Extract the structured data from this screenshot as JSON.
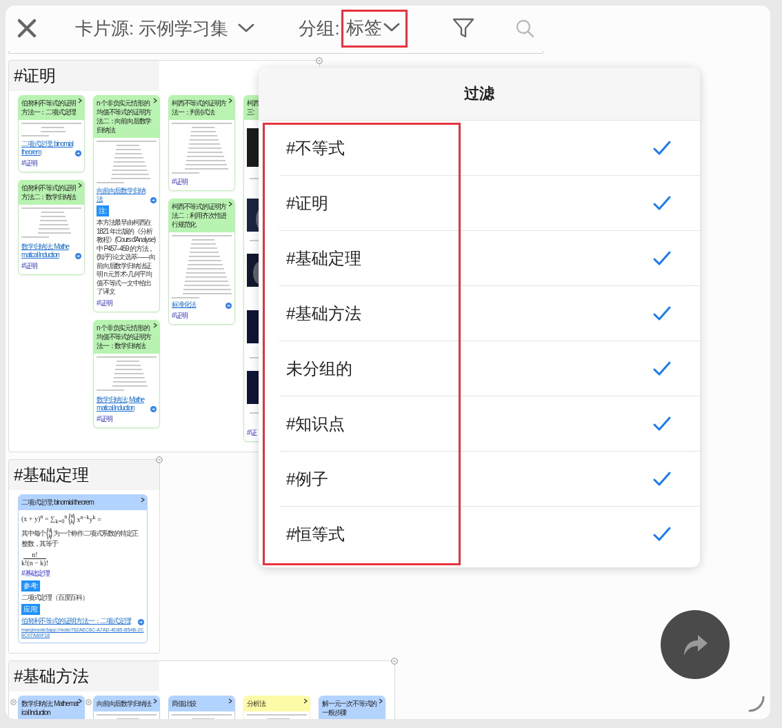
{
  "toolbar": {
    "source_label": "卡片源: 示例学习集",
    "group_label": "分组:",
    "group_value": "标签",
    "group_highlighted": true
  },
  "sections": [
    {
      "title": "#证明",
      "collapsed": false,
      "columns": [
        {
          "cards": [
            {
              "title": "伯努利不等式的证明方法一：二项式定理",
              "color": "#b9f3b1",
              "flagged": false,
              "blocks": [
                {
                  "kind": "formula"
                },
                {
                  "kind": "link",
                  "text": "二项式定理; binomial theorem",
                  "arrow": true
                },
                {
                  "kind": "tag",
                  "text": "#证明"
                }
              ]
            },
            {
              "title": "伯努利不等式的证明方法二：数学归纳法",
              "color": "#b9f3b1",
              "flagged": false,
              "blocks": [
                {
                  "kind": "formula"
                },
                {
                  "kind": "link",
                  "text": "数学归纳法; Mathematical Induction",
                  "arrow": true
                },
                {
                  "kind": "tag",
                  "text": "#证明"
                }
              ]
            }
          ]
        },
        {
          "cards": [
            {
              "title": "n 个非负实元情形的均值不等式的证明方法二：向前向后数学归纳法",
              "color": "#b9f3b1",
              "flagged": false,
              "blocks": [
                {
                  "kind": "formula"
                },
                {
                  "kind": "link",
                  "text": "向前向后数学归纳法",
                  "arrow": true
                },
                {
                  "kind": "label",
                  "text": "注:"
                },
                {
                  "kind": "text",
                  "text": "本方法最早由柯西在 1821 年出版的《分析教程》(Cours d'Analyse) 中 P457–459 的方法，(知乎) 论文选萃——向前向后数学归纳法证明 n 元算术-几何平均值不等式一文中给出了译文"
                },
                {
                  "kind": "tag",
                  "text": "#证明"
                }
              ]
            },
            {
              "title": "n 个非负实元情形的均值不等式的证明方法一：数学归纳法",
              "color": "#b9f3b1",
              "flagged": false,
              "blocks": [
                {
                  "kind": "formula"
                },
                {
                  "kind": "link",
                  "text": "数学归纳法; Mathematical Induction",
                  "arrow": true
                },
                {
                  "kind": "tag",
                  "text": "#证明"
                }
              ]
            }
          ]
        },
        {
          "cards": [
            {
              "title": "柯西不等式的证明方法一：判别式法",
              "color": "#b9f3b1",
              "flagged": false,
              "blocks": [
                {
                  "kind": "formula"
                },
                {
                  "kind": "tag",
                  "text": "#证明"
                }
              ]
            },
            {
              "title": "柯西不等式的证明方法二：利用齐次性进行规范化",
              "color": "#b9f3b1",
              "flagged": false,
              "blocks": [
                {
                  "kind": "formula"
                },
                {
                  "kind": "link",
                  "text": "标准化法",
                  "arrow": true
                },
                {
                  "kind": "tag",
                  "text": "#证明"
                }
              ]
            }
          ]
        },
        {
          "cards": [
            {
              "title_lines": [
                "柯西",
                "三:"
              ],
              "color": "#b9f3b1",
              "flagged": false,
              "blocks": [
                {
                  "kind": "picture"
                },
                {
                  "kind": "tag",
                  "text": "#证"
                }
              ]
            }
          ]
        }
      ]
    },
    {
      "title": "#基础定理",
      "collapsed": false,
      "columns": [
        {
          "cards": [
            {
              "title": "二项式定理; binomial theorem",
              "color": "#b3d3ff",
              "flagged": false,
              "blocks": [
                {
                  "kind": "equation",
                  "before": "(x + y)$^{n}$ = ∑$_{k=0}$$^{n}$",
                  "binom": [
                    "n",
                    "k"
                  ],
                  "after": "x$^{n−k}$y$^{k}$ ="
                },
                {
                  "kind": "binom_text",
                  "before": "其中每个",
                  "binom": [
                    "n",
                    "k"
                  ],
                  "after": "为一个称作二项式系数的特定正整数，其等于"
                },
                {
                  "kind": "fraction",
                  "numerator": "n!",
                  "denominator": "k!(n − k)!"
                },
                {
                  "kind": "tag",
                  "text": "#基础定理"
                },
                {
                  "kind": "label",
                  "text": "参考:"
                },
                {
                  "kind": "text",
                  "text": "二项式定理（百度百科）"
                },
                {
                  "kind": "label",
                  "text": "应用:"
                },
                {
                  "kind": "link",
                  "text": "伯努利不等式的证明方法一：二项式定理",
                  "arrow": true
                },
                {
                  "kind": "link",
                  "text": "marginnote3app://note/762AEC6C-A7AD-4D85-B54B-2C8C07A60F18",
                  "arrow": false
                }
              ]
            }
          ]
        }
      ]
    },
    {
      "title": "#基础方法",
      "collapsed": false,
      "columns": [
        {
          "cards": [
            {
              "title": "数学归纳法; Mathematical Induction",
              "color": "#b3d3ff",
              "flagged": true
            }
          ]
        },
        {
          "cards": [
            {
              "title": "向前向后数学归纳法",
              "color": "#b3d3ff",
              "flagged": true,
              "blocks": [
                {
                  "kind": "formula"
                }
              ]
            }
          ]
        },
        {
          "cards": [
            {
              "title": "商值比较",
              "color": "#b3d3ff",
              "flagged": false,
              "blocks": [
                {
                  "kind": "formula"
                }
              ]
            }
          ]
        },
        {
          "cards": [
            {
              "title": "分析法",
              "color": "#fdfba8",
              "flagged": false,
              "blocks": [
                {
                  "kind": "formula"
                }
              ]
            }
          ]
        },
        {
          "cards": [
            {
              "title": "解一元一次不等式的一般步骤",
              "color": "#b3d3ff",
              "flagged": false
            }
          ]
        }
      ]
    }
  ],
  "filter": {
    "title": "过滤",
    "highlighted": true,
    "items": [
      {
        "label": "#不等式",
        "checked": true
      },
      {
        "label": "#证明",
        "checked": true
      },
      {
        "label": "#基础定理",
        "checked": true
      },
      {
        "label": "#基础方法",
        "checked": true
      },
      {
        "label": "未分组的",
        "checked": true
      },
      {
        "label": "#知识点",
        "checked": true
      },
      {
        "label": "#例子",
        "checked": true
      },
      {
        "label": "#恒等式",
        "checked": true
      }
    ]
  }
}
